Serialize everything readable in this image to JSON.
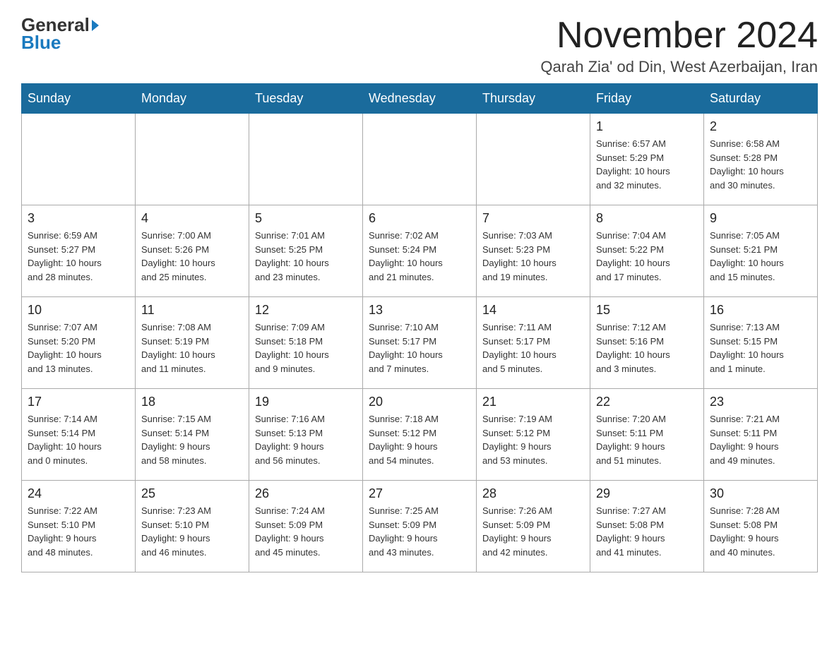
{
  "logo": {
    "general": "General",
    "blue": "Blue"
  },
  "header": {
    "month": "November 2024",
    "location": "Qarah Zia' od Din, West Azerbaijan, Iran"
  },
  "weekdays": [
    "Sunday",
    "Monday",
    "Tuesday",
    "Wednesday",
    "Thursday",
    "Friday",
    "Saturday"
  ],
  "weeks": [
    [
      {
        "day": "",
        "info": ""
      },
      {
        "day": "",
        "info": ""
      },
      {
        "day": "",
        "info": ""
      },
      {
        "day": "",
        "info": ""
      },
      {
        "day": "",
        "info": ""
      },
      {
        "day": "1",
        "info": "Sunrise: 6:57 AM\nSunset: 5:29 PM\nDaylight: 10 hours\nand 32 minutes."
      },
      {
        "day": "2",
        "info": "Sunrise: 6:58 AM\nSunset: 5:28 PM\nDaylight: 10 hours\nand 30 minutes."
      }
    ],
    [
      {
        "day": "3",
        "info": "Sunrise: 6:59 AM\nSunset: 5:27 PM\nDaylight: 10 hours\nand 28 minutes."
      },
      {
        "day": "4",
        "info": "Sunrise: 7:00 AM\nSunset: 5:26 PM\nDaylight: 10 hours\nand 25 minutes."
      },
      {
        "day": "5",
        "info": "Sunrise: 7:01 AM\nSunset: 5:25 PM\nDaylight: 10 hours\nand 23 minutes."
      },
      {
        "day": "6",
        "info": "Sunrise: 7:02 AM\nSunset: 5:24 PM\nDaylight: 10 hours\nand 21 minutes."
      },
      {
        "day": "7",
        "info": "Sunrise: 7:03 AM\nSunset: 5:23 PM\nDaylight: 10 hours\nand 19 minutes."
      },
      {
        "day": "8",
        "info": "Sunrise: 7:04 AM\nSunset: 5:22 PM\nDaylight: 10 hours\nand 17 minutes."
      },
      {
        "day": "9",
        "info": "Sunrise: 7:05 AM\nSunset: 5:21 PM\nDaylight: 10 hours\nand 15 minutes."
      }
    ],
    [
      {
        "day": "10",
        "info": "Sunrise: 7:07 AM\nSunset: 5:20 PM\nDaylight: 10 hours\nand 13 minutes."
      },
      {
        "day": "11",
        "info": "Sunrise: 7:08 AM\nSunset: 5:19 PM\nDaylight: 10 hours\nand 11 minutes."
      },
      {
        "day": "12",
        "info": "Sunrise: 7:09 AM\nSunset: 5:18 PM\nDaylight: 10 hours\nand 9 minutes."
      },
      {
        "day": "13",
        "info": "Sunrise: 7:10 AM\nSunset: 5:17 PM\nDaylight: 10 hours\nand 7 minutes."
      },
      {
        "day": "14",
        "info": "Sunrise: 7:11 AM\nSunset: 5:17 PM\nDaylight: 10 hours\nand 5 minutes."
      },
      {
        "day": "15",
        "info": "Sunrise: 7:12 AM\nSunset: 5:16 PM\nDaylight: 10 hours\nand 3 minutes."
      },
      {
        "day": "16",
        "info": "Sunrise: 7:13 AM\nSunset: 5:15 PM\nDaylight: 10 hours\nand 1 minute."
      }
    ],
    [
      {
        "day": "17",
        "info": "Sunrise: 7:14 AM\nSunset: 5:14 PM\nDaylight: 10 hours\nand 0 minutes."
      },
      {
        "day": "18",
        "info": "Sunrise: 7:15 AM\nSunset: 5:14 PM\nDaylight: 9 hours\nand 58 minutes."
      },
      {
        "day": "19",
        "info": "Sunrise: 7:16 AM\nSunset: 5:13 PM\nDaylight: 9 hours\nand 56 minutes."
      },
      {
        "day": "20",
        "info": "Sunrise: 7:18 AM\nSunset: 5:12 PM\nDaylight: 9 hours\nand 54 minutes."
      },
      {
        "day": "21",
        "info": "Sunrise: 7:19 AM\nSunset: 5:12 PM\nDaylight: 9 hours\nand 53 minutes."
      },
      {
        "day": "22",
        "info": "Sunrise: 7:20 AM\nSunset: 5:11 PM\nDaylight: 9 hours\nand 51 minutes."
      },
      {
        "day": "23",
        "info": "Sunrise: 7:21 AM\nSunset: 5:11 PM\nDaylight: 9 hours\nand 49 minutes."
      }
    ],
    [
      {
        "day": "24",
        "info": "Sunrise: 7:22 AM\nSunset: 5:10 PM\nDaylight: 9 hours\nand 48 minutes."
      },
      {
        "day": "25",
        "info": "Sunrise: 7:23 AM\nSunset: 5:10 PM\nDaylight: 9 hours\nand 46 minutes."
      },
      {
        "day": "26",
        "info": "Sunrise: 7:24 AM\nSunset: 5:09 PM\nDaylight: 9 hours\nand 45 minutes."
      },
      {
        "day": "27",
        "info": "Sunrise: 7:25 AM\nSunset: 5:09 PM\nDaylight: 9 hours\nand 43 minutes."
      },
      {
        "day": "28",
        "info": "Sunrise: 7:26 AM\nSunset: 5:09 PM\nDaylight: 9 hours\nand 42 minutes."
      },
      {
        "day": "29",
        "info": "Sunrise: 7:27 AM\nSunset: 5:08 PM\nDaylight: 9 hours\nand 41 minutes."
      },
      {
        "day": "30",
        "info": "Sunrise: 7:28 AM\nSunset: 5:08 PM\nDaylight: 9 hours\nand 40 minutes."
      }
    ]
  ]
}
